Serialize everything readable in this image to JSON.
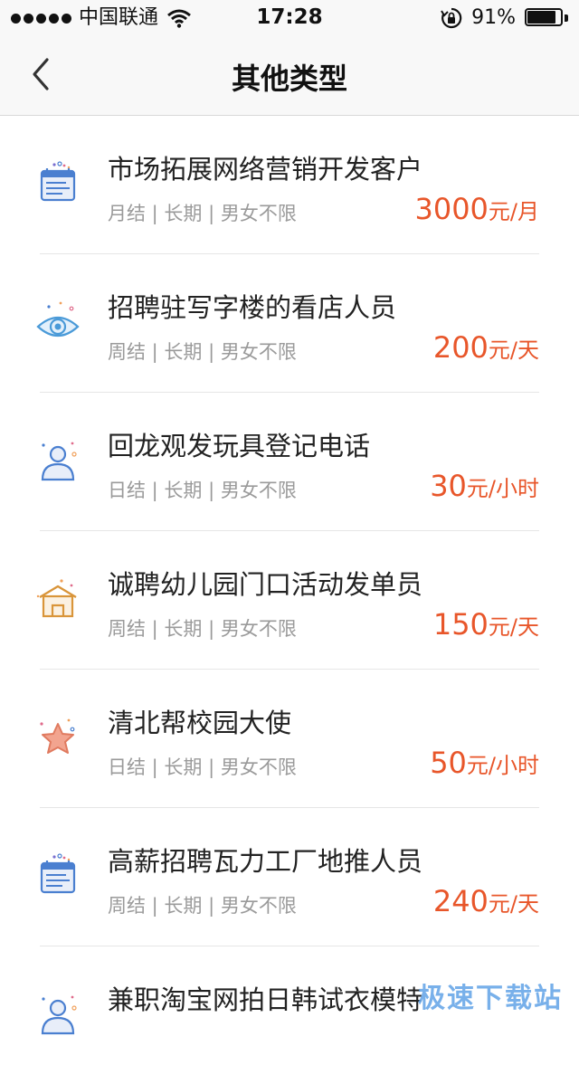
{
  "status_bar": {
    "carrier": "中国联通",
    "time": "17:28",
    "battery_percent_text": "91%",
    "battery_level": 0.91,
    "signal_bars": 5
  },
  "nav": {
    "title": "其他类型",
    "back_icon": "chevron-left-icon"
  },
  "colors": {
    "accent_pay": "#e8562a",
    "meta_gray": "#9a9a9a",
    "icon_blue": "#4a7fd0",
    "icon_orange": "#d9953a",
    "star_fill": "#f2a48f"
  },
  "jobs": [
    {
      "title": "市场拓展网络营销开发客户",
      "meta": "月结 | 长期 | 男女不限",
      "pay_amount": "3000",
      "pay_unit": "元/月",
      "icon": "calendar-icon"
    },
    {
      "title": "招聘驻写字楼的看店人员",
      "meta": "周结 | 长期 | 男女不限",
      "pay_amount": "200",
      "pay_unit": "元/天",
      "icon": "eye-icon"
    },
    {
      "title": "回龙观发玩具登记电话",
      "meta": "日结 | 长期 | 男女不限",
      "pay_amount": "30",
      "pay_unit": "元/小时",
      "icon": "person-icon"
    },
    {
      "title": "诚聘幼儿园门口活动发单员",
      "meta": "周结 | 长期 | 男女不限",
      "pay_amount": "150",
      "pay_unit": "元/天",
      "icon": "house-icon"
    },
    {
      "title": "清北帮校园大使",
      "meta": "日结 | 长期 | 男女不限",
      "pay_amount": "50",
      "pay_unit": "元/小时",
      "icon": "star-icon"
    },
    {
      "title": "高薪招聘瓦力工厂地推人员",
      "meta": "周结 | 长期 | 男女不限",
      "pay_amount": "240",
      "pay_unit": "元/天",
      "icon": "calendar-icon"
    },
    {
      "title": "兼职淘宝网拍日韩试衣模特",
      "meta": "",
      "pay_amount": "",
      "pay_unit": "",
      "icon": "person-icon"
    }
  ],
  "watermark": "极速下载站"
}
